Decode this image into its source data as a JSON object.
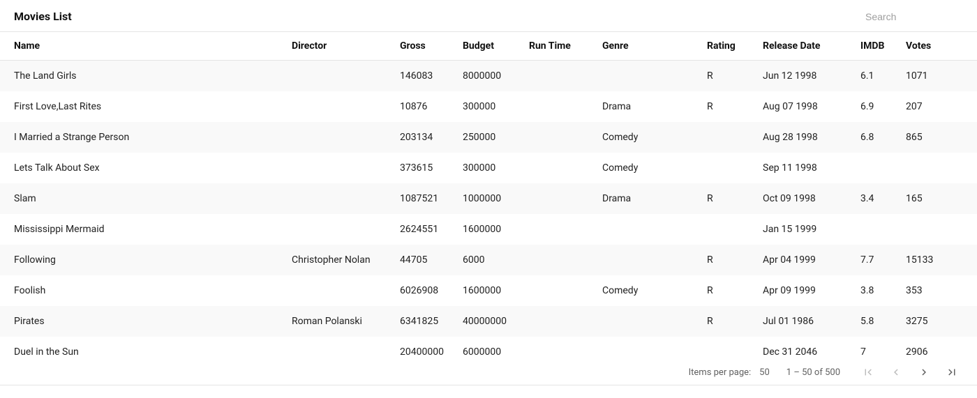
{
  "header": {
    "title": "Movies List",
    "search_placeholder": "Search"
  },
  "columns": [
    {
      "key": "name",
      "label": "Name"
    },
    {
      "key": "director",
      "label": "Director"
    },
    {
      "key": "gross",
      "label": "Gross"
    },
    {
      "key": "budget",
      "label": "Budget"
    },
    {
      "key": "runtime",
      "label": "Run Time"
    },
    {
      "key": "genre",
      "label": "Genre"
    },
    {
      "key": "rating",
      "label": "Rating"
    },
    {
      "key": "release",
      "label": "Release Date"
    },
    {
      "key": "imdb",
      "label": "IMDB"
    },
    {
      "key": "votes",
      "label": "Votes"
    }
  ],
  "rows": [
    {
      "name": "The Land Girls",
      "director": "",
      "gross": "146083",
      "budget": "8000000",
      "runtime": "",
      "genre": "",
      "rating": "R",
      "release": "Jun 12 1998",
      "imdb": "6.1",
      "votes": "1071"
    },
    {
      "name": "First Love,Last Rites",
      "director": "",
      "gross": "10876",
      "budget": "300000",
      "runtime": "",
      "genre": "Drama",
      "rating": "R",
      "release": "Aug 07 1998",
      "imdb": "6.9",
      "votes": "207"
    },
    {
      "name": "I Married a Strange Person",
      "director": "",
      "gross": "203134",
      "budget": "250000",
      "runtime": "",
      "genre": "Comedy",
      "rating": "",
      "release": "Aug 28 1998",
      "imdb": "6.8",
      "votes": "865"
    },
    {
      "name": "Lets Talk About Sex",
      "director": "",
      "gross": "373615",
      "budget": "300000",
      "runtime": "",
      "genre": "Comedy",
      "rating": "",
      "release": "Sep 11 1998",
      "imdb": "",
      "votes": ""
    },
    {
      "name": "Slam",
      "director": "",
      "gross": "1087521",
      "budget": "1000000",
      "runtime": "",
      "genre": "Drama",
      "rating": "R",
      "release": "Oct 09 1998",
      "imdb": "3.4",
      "votes": "165"
    },
    {
      "name": "Mississippi Mermaid",
      "director": "",
      "gross": "2624551",
      "budget": "1600000",
      "runtime": "",
      "genre": "",
      "rating": "",
      "release": "Jan 15 1999",
      "imdb": "",
      "votes": ""
    },
    {
      "name": "Following",
      "director": "Christopher Nolan",
      "gross": "44705",
      "budget": "6000",
      "runtime": "",
      "genre": "",
      "rating": "R",
      "release": "Apr 04 1999",
      "imdb": "7.7",
      "votes": "15133"
    },
    {
      "name": "Foolish",
      "director": "",
      "gross": "6026908",
      "budget": "1600000",
      "runtime": "",
      "genre": "Comedy",
      "rating": "R",
      "release": "Apr 09 1999",
      "imdb": "3.8",
      "votes": "353"
    },
    {
      "name": "Pirates",
      "director": "Roman Polanski",
      "gross": "6341825",
      "budget": "40000000",
      "runtime": "",
      "genre": "",
      "rating": "R",
      "release": "Jul 01 1986",
      "imdb": "5.8",
      "votes": "3275"
    },
    {
      "name": "Duel in the Sun",
      "director": "",
      "gross": "20400000",
      "budget": "6000000",
      "runtime": "",
      "genre": "",
      "rating": "",
      "release": "Dec 31 2046",
      "imdb": "7",
      "votes": "2906"
    }
  ],
  "paginator": {
    "items_per_page_label": "Items per page:",
    "items_per_page_value": "50",
    "range_label": "1 – 50 of 500"
  }
}
